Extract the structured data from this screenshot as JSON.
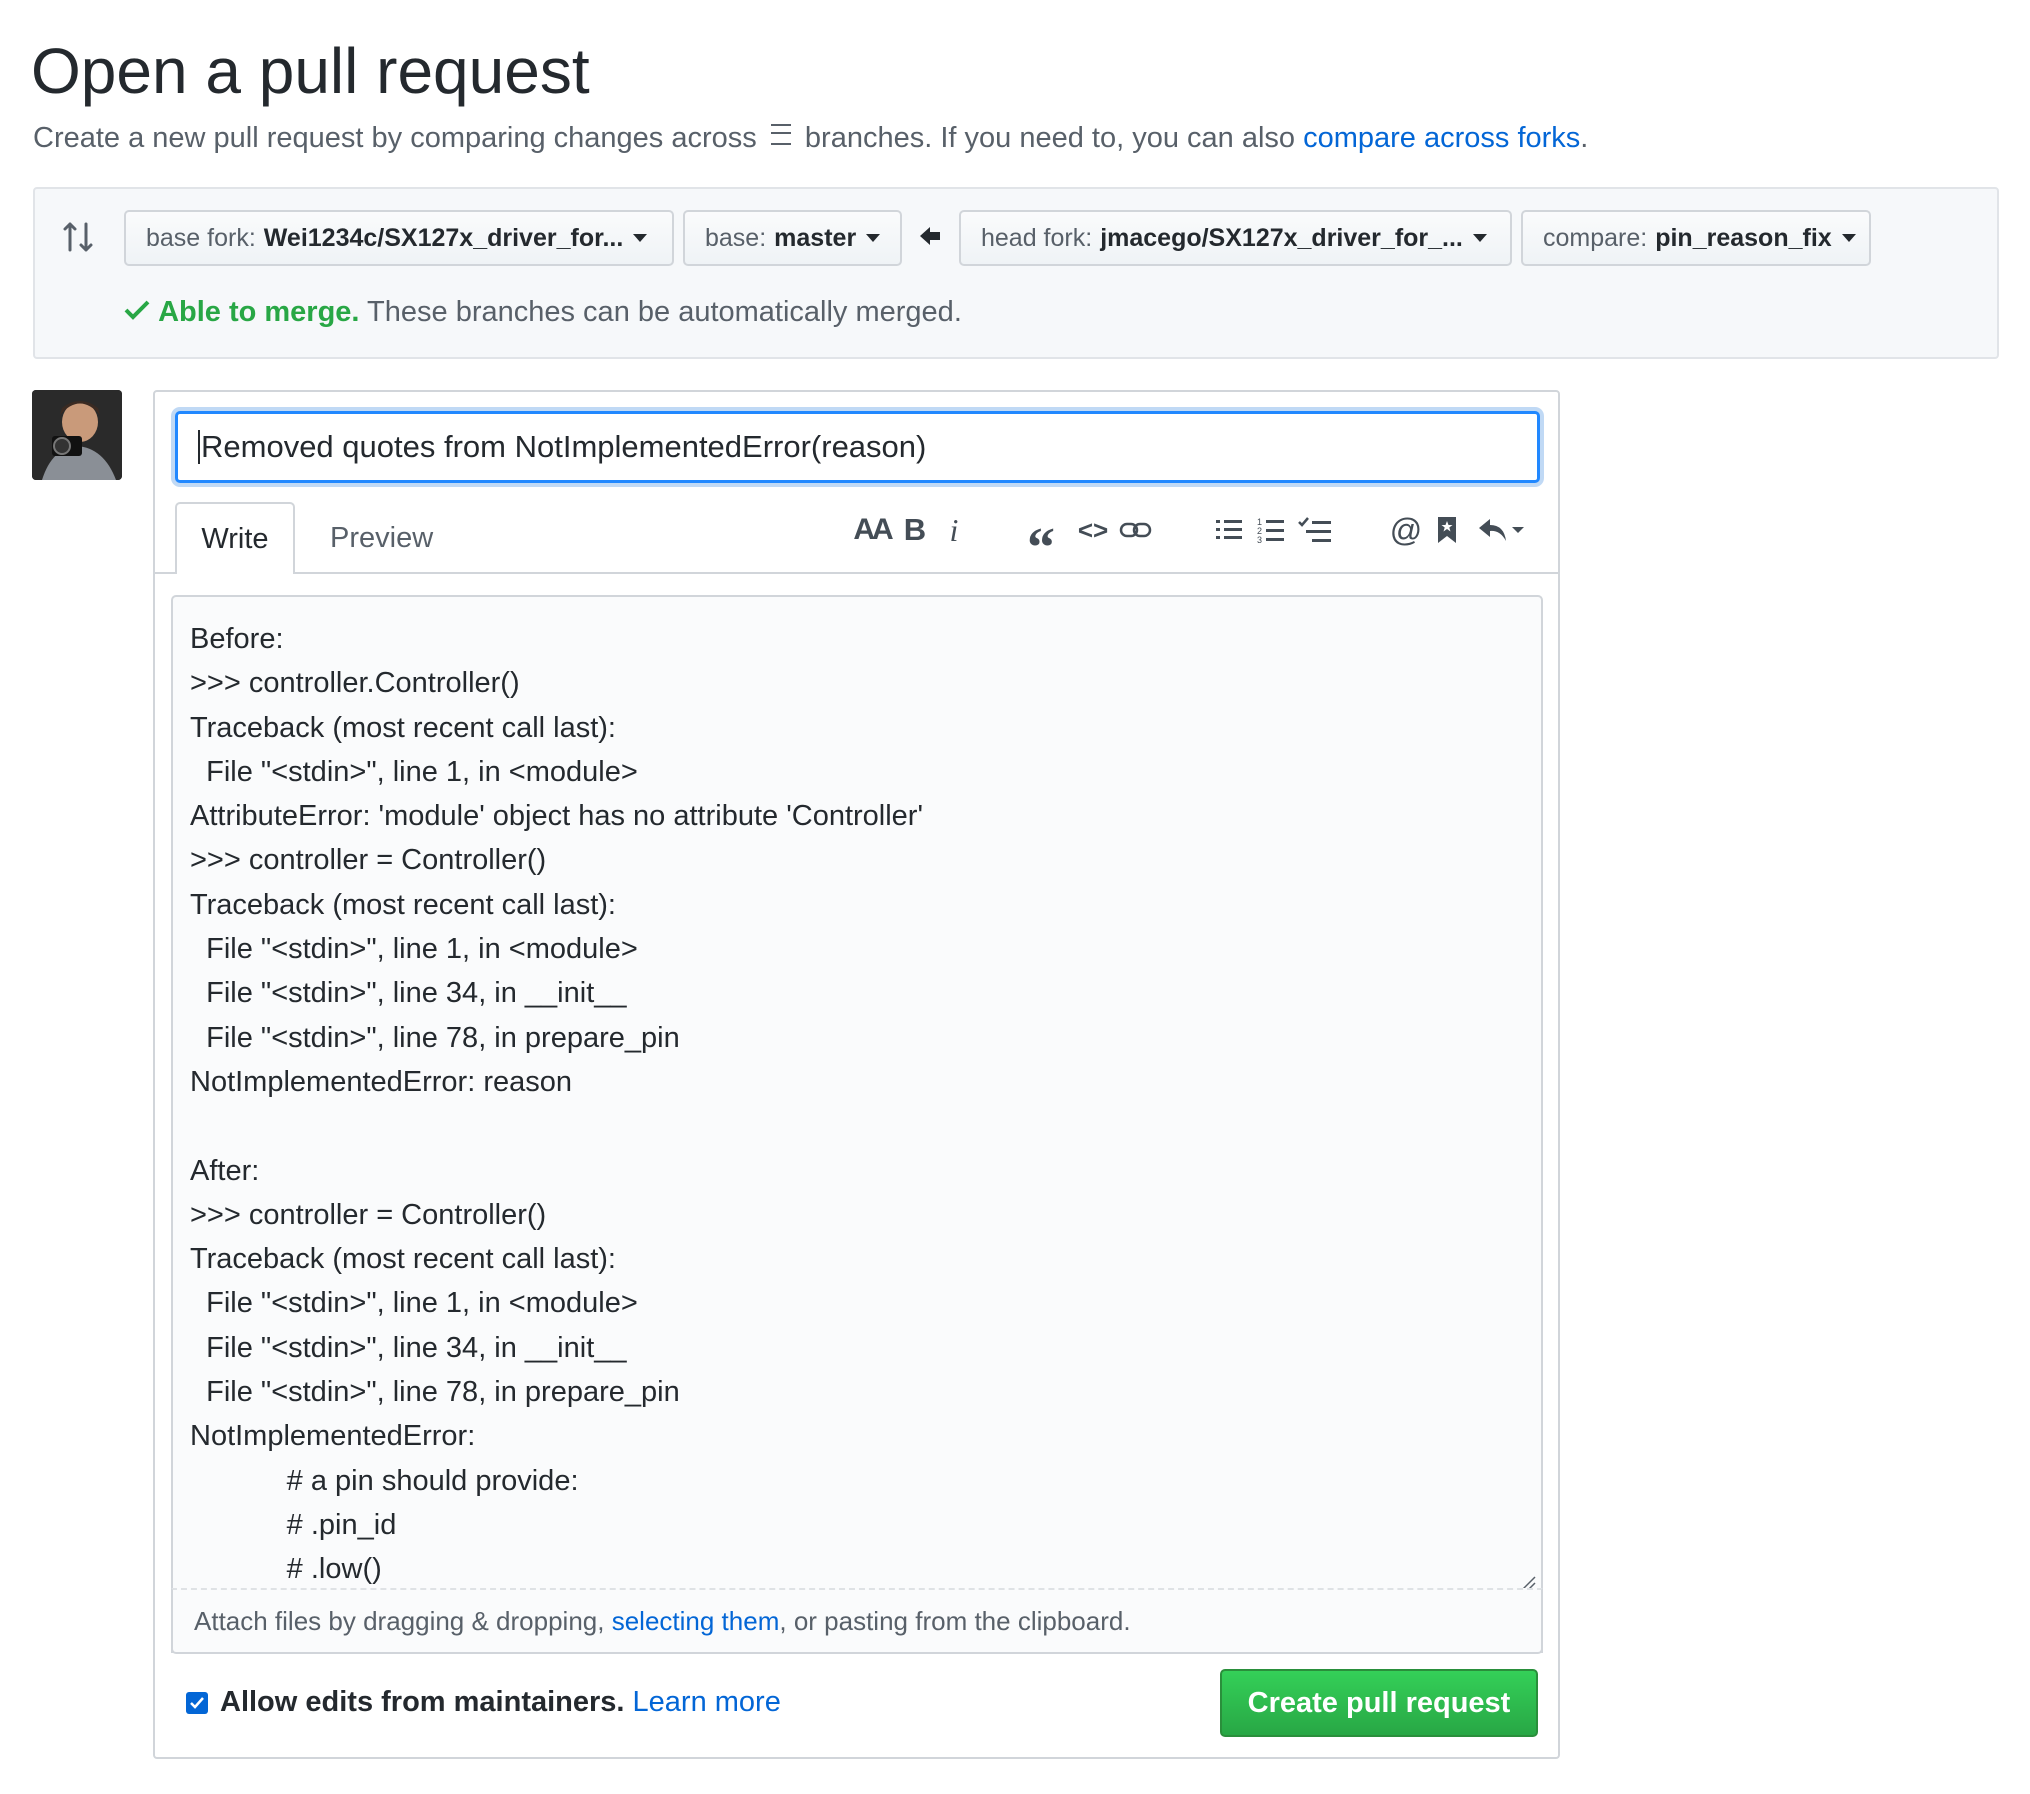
{
  "header": {
    "title": "Open a pull request",
    "subtitle_before": "Create a new pull request by comparing changes across",
    "subtitle_middle": "branches. If you need to, you can also",
    "subtitle_link": "compare across forks",
    "subtitle_end": "."
  },
  "compare": {
    "base_fork_label": "base fork:",
    "base_fork_value": "Wei1234c/SX127x_driver_for...",
    "base_label": "base:",
    "base_value": "master",
    "head_fork_label": "head fork:",
    "head_fork_value": "jmacego/SX127x_driver_for_...",
    "compare_label": "compare:",
    "compare_value": "pin_reason_fix",
    "merge_status_bold": "Able to merge.",
    "merge_status_text": "These branches can be automatically merged."
  },
  "form": {
    "title_value": "Removed quotes from NotImplementedError(reason)",
    "tab_write": "Write",
    "tab_preview": "Preview",
    "body": "Before:\n>>> controller.Controller()\nTraceback (most recent call last):\n  File \"<stdin>\", line 1, in <module>\nAttributeError: 'module' object has no attribute 'Controller'\n>>> controller = Controller()\nTraceback (most recent call last):\n  File \"<stdin>\", line 1, in <module>\n  File \"<stdin>\", line 34, in __init__\n  File \"<stdin>\", line 78, in prepare_pin\nNotImplementedError: reason\n\nAfter:\n>>> controller = Controller()\nTraceback (most recent call last):\n  File \"<stdin>\", line 1, in <module>\n  File \"<stdin>\", line 34, in __init__\n  File \"<stdin>\", line 78, in prepare_pin\nNotImplementedError:\n            # a pin should provide:\n            # .pin_id\n            # .low()",
    "attach_before": "Attach files by dragging & dropping,",
    "attach_link": "selecting them",
    "attach_after": ", or pasting from the clipboard.",
    "allow_edits_label": "Allow edits from maintainers.",
    "learn_more": "Learn more",
    "submit_label": "Create pull request"
  },
  "toolbar": {
    "header_glyph": "AA",
    "bold_glyph": "B",
    "italic_glyph": "i",
    "quote_glyph": "“",
    "code_glyph": "<>",
    "mention_glyph": "@"
  },
  "colors": {
    "accent": "#0366d6",
    "success": "#28a745",
    "focus_ring": "#2188ff"
  }
}
